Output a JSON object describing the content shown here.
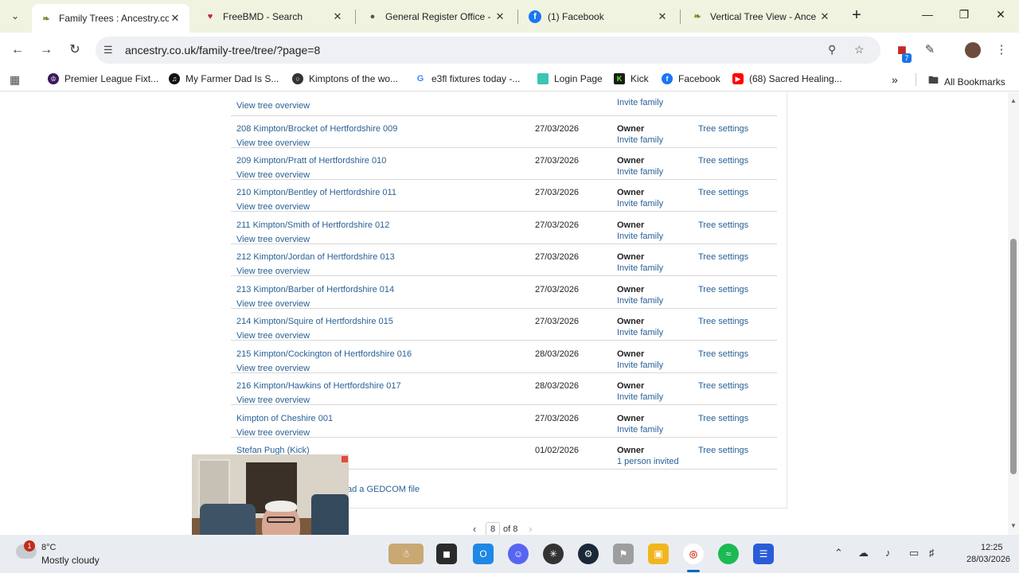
{
  "browser": {
    "tabs": [
      {
        "title": "Family Trees : Ancestry.co",
        "active": true,
        "icon": "ancestry-leaf-icon"
      },
      {
        "title": "FreeBMD - Search",
        "active": false,
        "icon": "freebmd-icon"
      },
      {
        "title": "General Register Office -",
        "active": false,
        "icon": "globe-icon"
      },
      {
        "title": "(1) Facebook",
        "active": false,
        "icon": "facebook-icon"
      },
      {
        "title": "Vertical Tree View - Ance",
        "active": false,
        "icon": "ancestry-leaf-icon"
      }
    ],
    "url": "ancestry.co.uk/family-tree/tree/?page=8",
    "extension_badge": "7",
    "bookmarks": [
      {
        "label": "Premier League Fixt...",
        "icon": "premier-league-icon"
      },
      {
        "label": "My Farmer Dad Is S...",
        "icon": "tiktok-icon"
      },
      {
        "label": "Kimptons of the wo...",
        "icon": "globe-icon"
      },
      {
        "label": "e3fl fixtures today -...",
        "icon": "google-icon"
      },
      {
        "label": "Login Page",
        "icon": "login-icon"
      },
      {
        "label": "Kick",
        "icon": "kick-icon"
      },
      {
        "label": "Facebook",
        "icon": "facebook-icon"
      },
      {
        "label": "(68) Sacred Healing...",
        "icon": "youtube-icon"
      }
    ],
    "all_bookmarks": "All Bookmarks"
  },
  "page": {
    "top_partial": {
      "overview": "View tree overview",
      "invite": "Invite family"
    },
    "trees": [
      {
        "name": "208 Kimpton/Brocket of Hertfordshire 009",
        "overview": "View tree overview",
        "date": "27/03/2026",
        "role": "Owner",
        "invite": "Invite family",
        "settings": "Tree settings"
      },
      {
        "name": "209 Kimpton/Pratt of Hertfordshire 010",
        "overview": "View tree overview",
        "date": "27/03/2026",
        "role": "Owner",
        "invite": "Invite family",
        "settings": "Tree settings"
      },
      {
        "name": "210 Kimpton/Bentley of Hertfordshire 011",
        "overview": "View tree overview",
        "date": "27/03/2026",
        "role": "Owner",
        "invite": "Invite family",
        "settings": "Tree settings"
      },
      {
        "name": "211 Kimpton/Smith of Hertfordshire 012",
        "overview": "View tree overview",
        "date": "27/03/2026",
        "role": "Owner",
        "invite": "Invite family",
        "settings": "Tree settings"
      },
      {
        "name": "212 Kimpton/Jordan of Hertfordshire 013",
        "overview": "View tree overview",
        "date": "27/03/2026",
        "role": "Owner",
        "invite": "Invite family",
        "settings": "Tree settings"
      },
      {
        "name": "213 Kimpton/Barber of Hertfordshire 014",
        "overview": "View tree overview",
        "date": "27/03/2026",
        "role": "Owner",
        "invite": "Invite family",
        "settings": "Tree settings"
      },
      {
        "name": "214 Kimpton/Squire of Hertfordshire 015",
        "overview": "View tree overview",
        "date": "27/03/2026",
        "role": "Owner",
        "invite": "Invite family",
        "settings": "Tree settings"
      },
      {
        "name": "215 Kimpton/Cockington of Hertfordshire 016",
        "overview": "View tree overview",
        "date": "28/03/2026",
        "role": "Owner",
        "invite": "Invite family",
        "settings": "Tree settings"
      },
      {
        "name": "216 Kimpton/Hawkins of Hertfordshire 017",
        "overview": "View tree overview",
        "date": "28/03/2026",
        "role": "Owner",
        "invite": "Invite family",
        "settings": "Tree settings"
      },
      {
        "name": "Kimpton of Cheshire 001",
        "overview": "View tree overview",
        "date": "27/03/2026",
        "role": "Owner",
        "invite": "Invite family",
        "settings": "Tree settings"
      },
      {
        "name": "Stefan Pugh (Kick)",
        "overview": "",
        "date": "01/02/2026",
        "role": "Owner",
        "invite": "1 person invited",
        "settings": "Tree settings"
      }
    ],
    "upload_link": "ad a GEDCOM file",
    "pagination": {
      "current": "8",
      "of_text": "of 8"
    }
  },
  "taskbar": {
    "weather": {
      "temp": "8°C",
      "desc": "Mostly cloudy",
      "badge": "1"
    },
    "time": "12:25",
    "date": "28/03/2026"
  }
}
